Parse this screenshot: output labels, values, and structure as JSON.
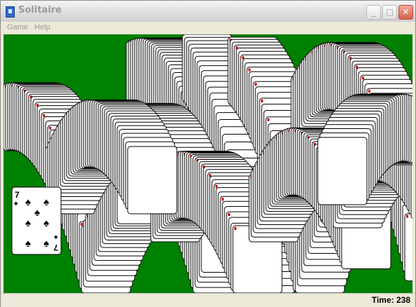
{
  "window": {
    "title": "Solitaire"
  },
  "menu": {
    "items": [
      "Game",
      "Help"
    ]
  },
  "status": {
    "time_label": "Time: 238"
  },
  "colors": {
    "felt": "#008000",
    "card_back_lines": "#000000",
    "red_suit": "#cc0000"
  },
  "top_card": {
    "rank": "7",
    "suit": "spades"
  }
}
